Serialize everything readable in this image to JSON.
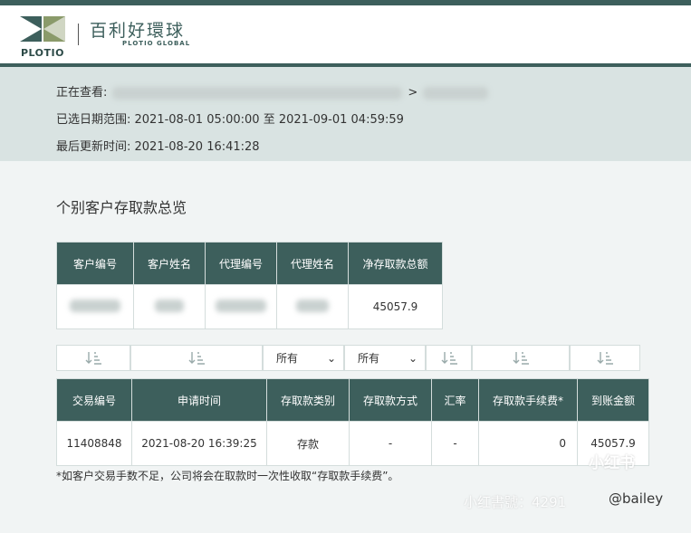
{
  "brand": {
    "logo_text": "PLOTIO",
    "name_cn": "百利好環球",
    "name_en": "PLOTIO GLOBAL"
  },
  "info": {
    "viewing_label": "正在查看:",
    "viewing_separator": ">",
    "date_range": "已选日期范围: 2021-08-01 05:00:00 至 2021-09-01 04:59:59",
    "last_updated": "最后更新时间: 2021-08-20 16:41:28"
  },
  "section_title": "个别客户存取款总览",
  "summary_table": {
    "headers": [
      "客户编号",
      "客户姓名",
      "代理编号",
      "代理姓名",
      "净存取款总额"
    ],
    "net_total": "45057.9"
  },
  "filters": {
    "type_selected": "所有",
    "method_selected": "所有"
  },
  "tx_table": {
    "headers": [
      "交易编号",
      "申请时间",
      "存取款类别",
      "存取款方式",
      "汇率",
      "存取款手续费*",
      "到账金额"
    ],
    "rows": [
      [
        "11408848",
        "2021-08-20 16:39:25",
        "存款",
        "-",
        "-",
        "0",
        "45057.9"
      ]
    ]
  },
  "note": "*如客户交易手数不足，公司将会在取款时一次性收取“存取款手续费”。",
  "watermark": {
    "brand": "小红书",
    "id_text": "小红書號：4291",
    "handle": "@bailey"
  },
  "colors": {
    "primary": "#3d5f5c",
    "info_bg": "#d9e3e2",
    "page_bg": "#f1f4f4"
  }
}
